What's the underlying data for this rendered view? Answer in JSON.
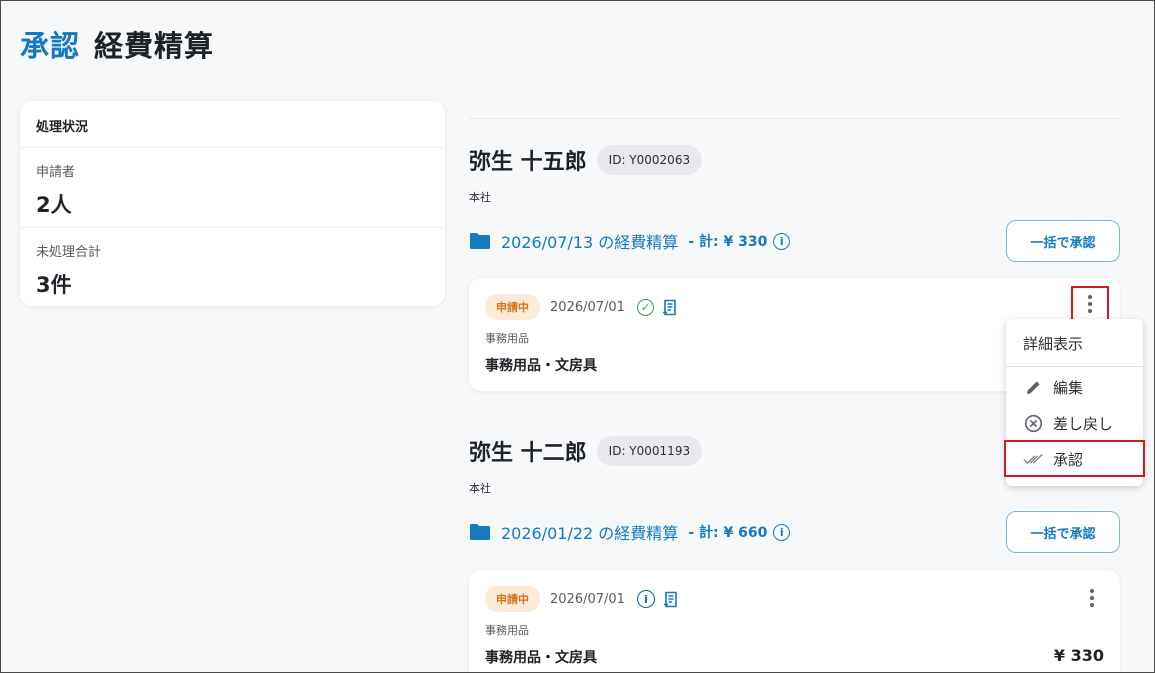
{
  "page": {
    "title_accent": "承認",
    "title_main": "経費精算"
  },
  "status_card": {
    "heading": "処理状況",
    "rows": [
      {
        "label": "申請者",
        "value": "2人"
      },
      {
        "label": "未処理合計",
        "value": "3件"
      }
    ]
  },
  "applicants": [
    {
      "name": "弥生 十五郎",
      "id": "ID: Y0002063",
      "branch": "本社",
      "claim": {
        "title": "2026/07/13 の経費精算",
        "total": "- 計: ¥ 330",
        "bulk_button": "一括で承認"
      },
      "item": {
        "status": "申請中",
        "date": "2026/07/01",
        "category": "事務用品",
        "name": "事務用品・文房具",
        "amount": ""
      }
    },
    {
      "name": "弥生 十二郎",
      "id": "ID: Y0001193",
      "branch": "本社",
      "claim": {
        "title": "2026/01/22 の経費精算",
        "total": "- 計: ¥ 660",
        "bulk_button": "一括で承認"
      },
      "item": {
        "status": "申請中",
        "date": "2026/07/01",
        "category": "事務用品",
        "name": "事務用品・文房具",
        "amount": "¥ 330"
      }
    }
  ],
  "context_menu": {
    "items": [
      {
        "label": "詳細表示",
        "icon": "none"
      },
      {
        "label": "編集",
        "icon": "pencil-icon"
      },
      {
        "label": "差し戻し",
        "icon": "cancel-circle-icon"
      },
      {
        "label": "承認",
        "icon": "double-check-icon"
      }
    ]
  },
  "colors": {
    "accent": "#1479bf",
    "status_pending_bg": "#fdebd9",
    "status_pending_text": "#d9731a",
    "highlight": "#d7191c",
    "verified": "#2e9b57"
  }
}
